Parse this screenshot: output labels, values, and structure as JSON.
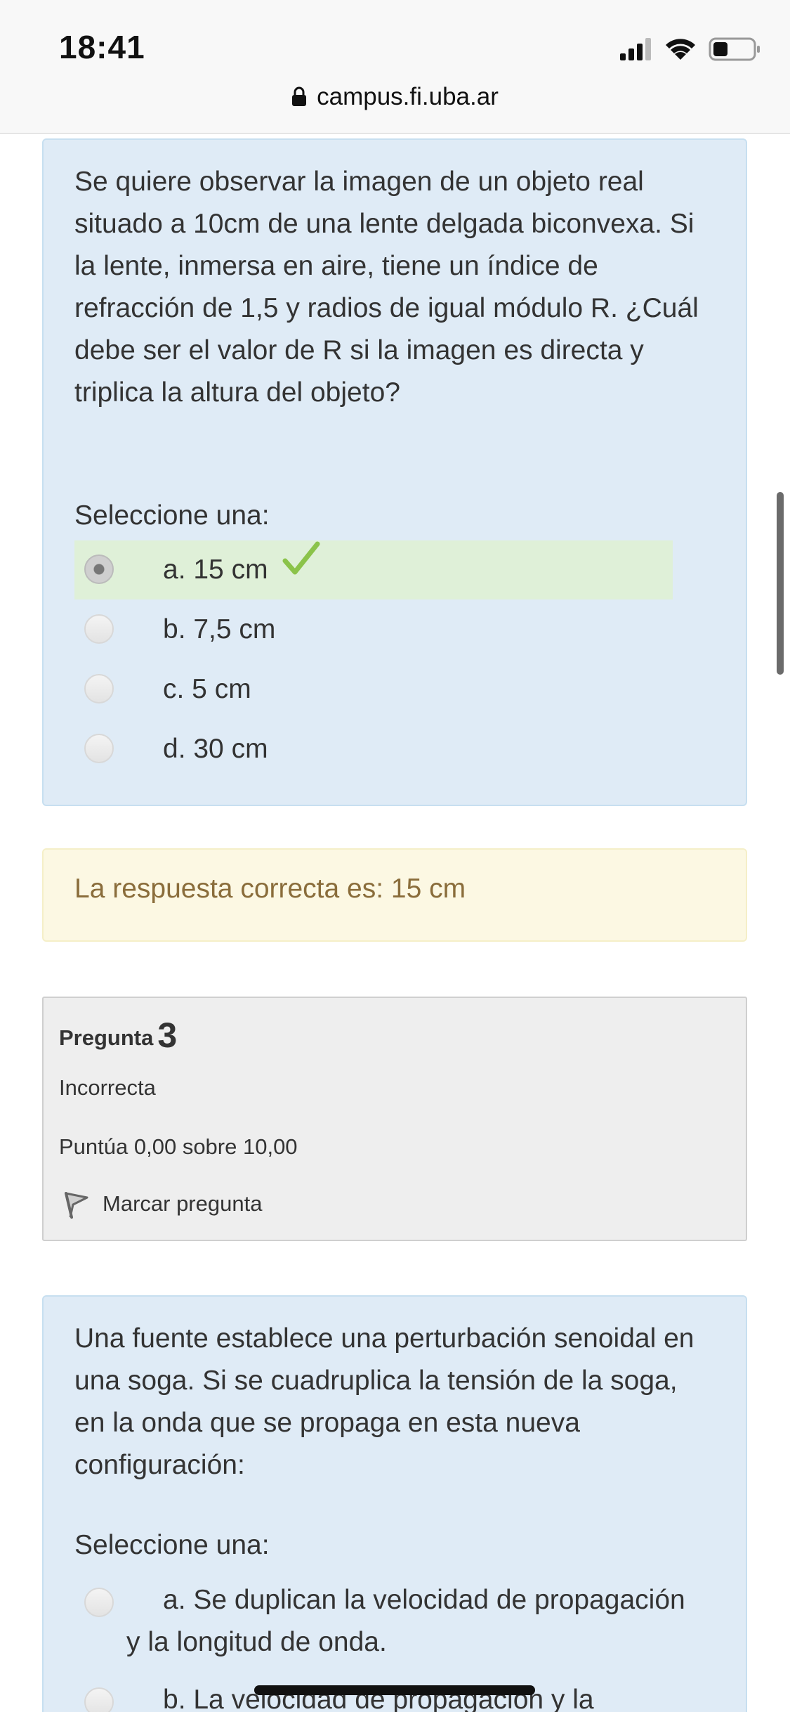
{
  "status_bar": {
    "time": "18:41"
  },
  "browser": {
    "url": "campus.fi.uba.ar"
  },
  "question2": {
    "prompt": "Se quiere observar la imagen de un objeto real situado a 10cm de una lente delgada biconvexa.  Si la lente, inmersa en aire, tiene un índice de refracción de 1,5 y radios de igual módulo R. ¿Cuál debe ser el valor de R si la imagen es directa y triplica la altura del objeto?",
    "select_label": "Seleccione una:",
    "options": [
      {
        "label": "a. 15 cm",
        "selected": true,
        "correct": true
      },
      {
        "label": "b. 7,5 cm",
        "selected": false
      },
      {
        "label": "c. 5 cm",
        "selected": false
      },
      {
        "label": "d. 30 cm",
        "selected": false
      }
    ],
    "feedback": "La respuesta correcta es: 15 cm"
  },
  "question3_info": {
    "label": "Pregunta",
    "number": "3",
    "state": "Incorrecta",
    "grade": "Puntúa 0,00 sobre 10,00",
    "flag_label": "Marcar pregunta"
  },
  "question3": {
    "prompt": "Una fuente establece una perturbación senoidal  en una soga. Si se cuadruplica la tensión de la soga, en la onda que se propaga en esta nueva configuración:",
    "select_label": "Seleccione una:",
    "options": [
      {
        "label": "a. Se duplican la velocidad de propagación y la longitud de onda."
      },
      {
        "label": "b. La velocidad de propagación y la"
      }
    ]
  },
  "colors": {
    "question_bg": "#dfebf6",
    "correct_bg": "#dff0d8",
    "feedback_bg": "#fcf8e3",
    "feedback_text": "#8a6d3b",
    "info_bg": "#eeeeee",
    "check": "#8bc34a"
  }
}
